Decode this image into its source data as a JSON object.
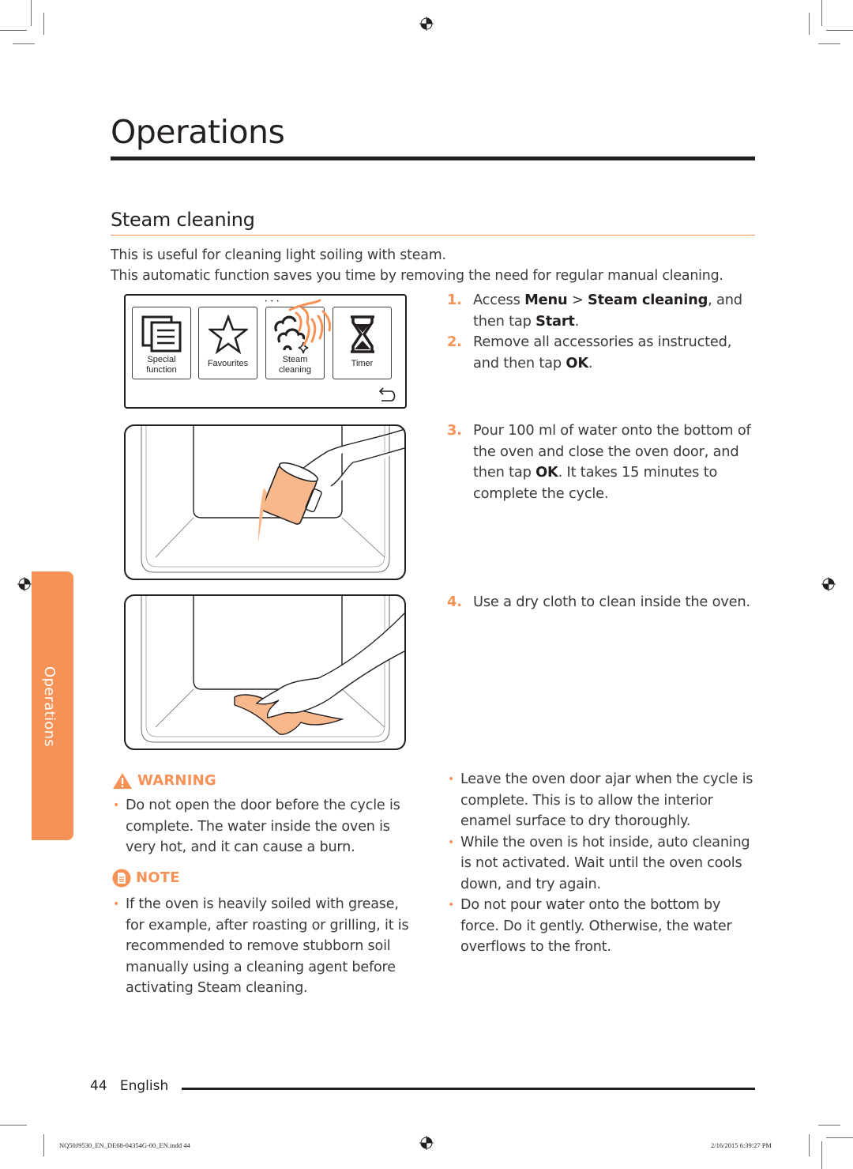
{
  "header": {
    "chapter_title": "Operations",
    "section_title": "Steam cleaning"
  },
  "intro": [
    "This is useful for cleaning light soiling with steam.",
    "This automatic function saves you time by removing the need for regular manual cleaning."
  ],
  "panel": {
    "tiles": [
      {
        "label_line1": "Special",
        "label_line2": "function",
        "icon": "special-function-icon"
      },
      {
        "label_line1": "Favourites",
        "label_line2": "",
        "icon": "star-icon"
      },
      {
        "label_line1": "Steam",
        "label_line2": "cleaning",
        "icon": "steam-cleaning-icon"
      },
      {
        "label_line1": "Timer",
        "label_line2": "",
        "icon": "hourglass-icon"
      }
    ],
    "page_indicator": "• • •",
    "back_icon": "back-arrow-icon",
    "highlight_color": "#f79256"
  },
  "steps": [
    {
      "num": "1.",
      "parts": [
        "Access ",
        "Menu",
        " > ",
        "Steam cleaning",
        ", and then tap ",
        "Start",
        "."
      ]
    },
    {
      "num": "2.",
      "parts": [
        "Remove all accessories as instructed, and then tap ",
        "OK",
        "."
      ]
    },
    {
      "num": "3.",
      "parts": [
        "Pour 100 ml of water onto the bottom of the oven and close the oven door, and then tap ",
        "OK",
        ". It takes 15 minutes to complete the cycle."
      ]
    },
    {
      "num": "4.",
      "parts": [
        "Use a dry cloth to clean inside the oven."
      ]
    }
  ],
  "warning": {
    "heading": "WARNING",
    "icon": "warning-triangle-icon",
    "items": [
      "Do not open the door before the cycle is complete. The water inside the oven is very hot, and it can cause a burn."
    ]
  },
  "note": {
    "heading": "NOTE",
    "icon": "note-icon",
    "items": [
      "If the oven is heavily soiled with grease, for example, after roasting or grilling, it is recommended to remove stubborn soil manually using a cleaning agent before activating Steam cleaning."
    ]
  },
  "right_notes": [
    "Leave the oven door ajar when the cycle is complete. This is to allow the interior enamel surface to dry thoroughly.",
    "While the oven is hot inside, auto cleaning is not activated. Wait until the oven cools down, and try again.",
    "Do not pour water onto the bottom by force. Do it gently. Otherwise, the water overflows to the front."
  ],
  "side_tab": {
    "label": "Operations"
  },
  "footer": {
    "page_number": "44",
    "language": "English",
    "file_slug": "NQ50J9530_EN_DE68-04354G-00_EN.indd   44",
    "timestamp": "2/16/2015   6:39:27 PM"
  },
  "colors": {
    "accent": "#f79256",
    "text": "#231f20",
    "body_text": "#3c3a3b",
    "water": "#f8b88b"
  }
}
